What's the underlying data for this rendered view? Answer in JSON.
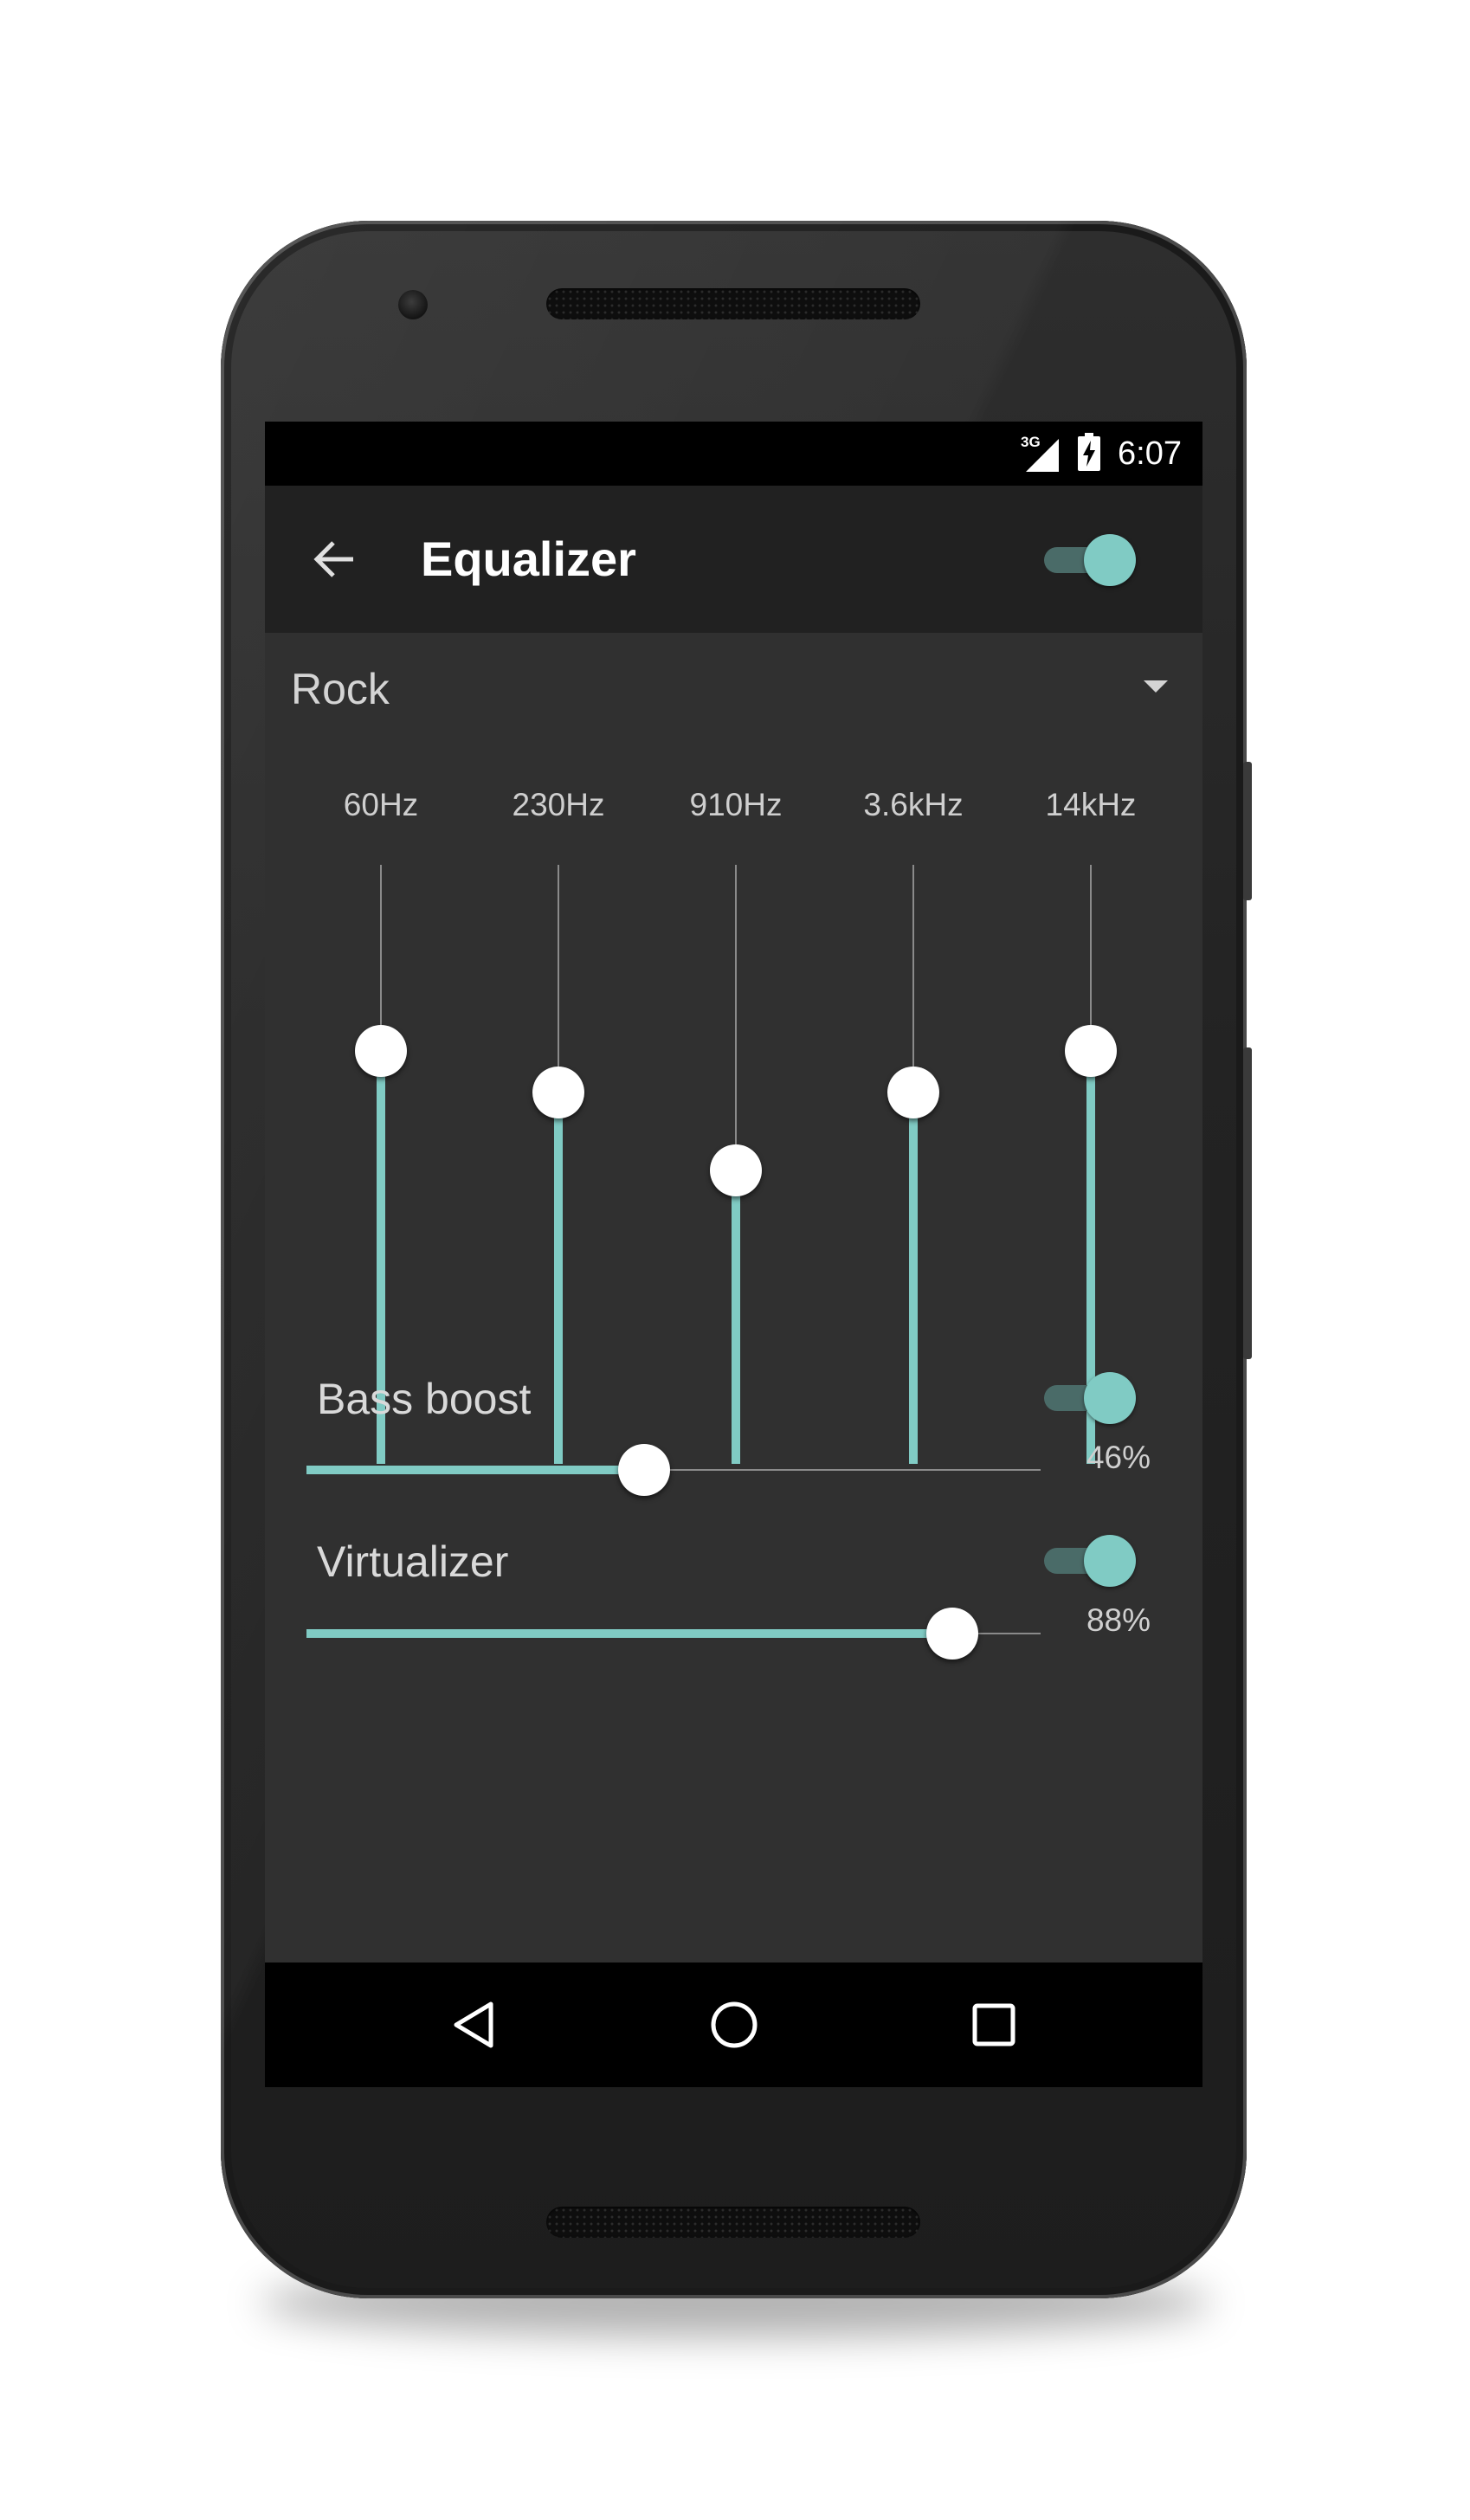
{
  "status_bar": {
    "network_type": "3G",
    "time": "6:07",
    "icons": [
      "signal-icon",
      "battery-charging-icon"
    ]
  },
  "app_bar": {
    "title": "Equalizer",
    "back_icon": "arrow-back-icon",
    "equalizer_enabled": true
  },
  "preset": {
    "selected": "Rock",
    "dropdown_icon": "dropdown-arrow-icon"
  },
  "bands": [
    {
      "label": "60Hz",
      "level": 0.69
    },
    {
      "label": "230Hz",
      "level": 0.62
    },
    {
      "label": "910Hz",
      "level": 0.49
    },
    {
      "label": "3.6kHz",
      "level": 0.62
    },
    {
      "label": "14kHz",
      "level": 0.69
    }
  ],
  "bass_boost": {
    "label": "Bass boost",
    "enabled": true,
    "percent": 46,
    "percent_text": "46%"
  },
  "virtualizer": {
    "label": "Virtualizer",
    "enabled": true,
    "percent": 88,
    "percent_text": "88%"
  },
  "nav_bar": {
    "icons": [
      "nav-back-icon",
      "nav-home-icon",
      "nav-recents-icon"
    ]
  },
  "colors": {
    "accent": "#80cbc4",
    "background": "#303030",
    "app_bar": "#212121",
    "status_bar": "#000000"
  }
}
